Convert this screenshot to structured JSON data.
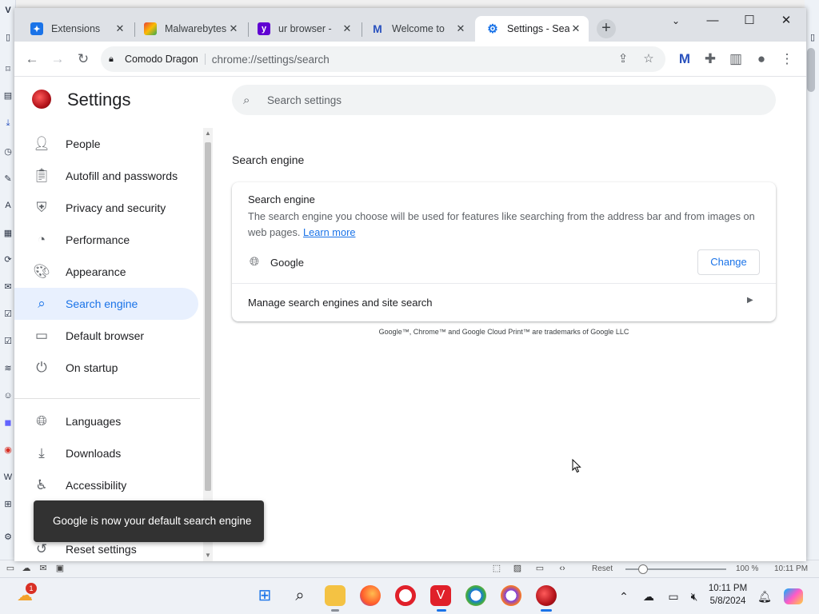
{
  "browser": {
    "tabs": [
      {
        "title": "Extensions",
        "icon": "puzzle-icon",
        "color": "#1a73e8",
        "active": false
      },
      {
        "title": "Malwarebytes",
        "icon": "malwarebytes-colorful-icon",
        "color": "#e94235",
        "active": false
      },
      {
        "title": "ur browser -",
        "icon": "yahoo-icon",
        "color": "#6001d2",
        "active": false
      },
      {
        "title": "Welcome to",
        "icon": "malwarebytes-m-icon",
        "color": "#2a52be",
        "active": false
      },
      {
        "title": "Settings - Sea",
        "icon": "gear-icon",
        "color": "#1a73e8",
        "active": true
      }
    ],
    "site_chip": "Comodo Dragon",
    "url": "chrome://settings/search"
  },
  "settings": {
    "title": "Settings",
    "search_placeholder": "Search settings",
    "nav": [
      {
        "label": "People",
        "icon": "person-icon",
        "active": false
      },
      {
        "label": "Autofill and passwords",
        "icon": "clipboard-icon",
        "active": false
      },
      {
        "label": "Privacy and security",
        "icon": "shield-icon",
        "active": false
      },
      {
        "label": "Performance",
        "icon": "speedometer-icon",
        "active": false
      },
      {
        "label": "Appearance",
        "icon": "palette-icon",
        "active": false
      },
      {
        "label": "Search engine",
        "icon": "search-icon",
        "active": true
      },
      {
        "label": "Default browser",
        "icon": "browser-window-icon",
        "active": false
      },
      {
        "label": "On startup",
        "icon": "power-icon",
        "active": false
      },
      {
        "label": "Languages",
        "icon": "globe-icon",
        "active": false
      },
      {
        "label": "Downloads",
        "icon": "download-icon",
        "active": false
      },
      {
        "label": "Accessibility",
        "icon": "accessibility-icon",
        "active": false
      },
      {
        "label": "Reset settings",
        "icon": "reset-icon",
        "active": false
      }
    ],
    "section_heading": "Search engine",
    "card": {
      "title": "Search engine",
      "description": "The search engine you choose will be used for features like searching from the address bar and from images on web pages.",
      "learn_more": "Learn more",
      "engine_name": "Google",
      "change_label": "Change",
      "manage_label": "Manage search engines and site search"
    },
    "trademark": "Google™, Chrome™ and Google Cloud Print™ are trademarks of Google LLC",
    "toast": "Google is now your default search engine"
  },
  "taskbar": {
    "weather_badge": "1",
    "time": "10:11 PM",
    "date": "5/8/2024"
  },
  "background_app": {
    "zoom": "100 %",
    "reset_label": "Reset",
    "time": "10:11 PM"
  },
  "colors": {
    "accent": "#1a73e8",
    "active_nav_bg": "#e8f0fe",
    "toast_bg": "#323232"
  }
}
